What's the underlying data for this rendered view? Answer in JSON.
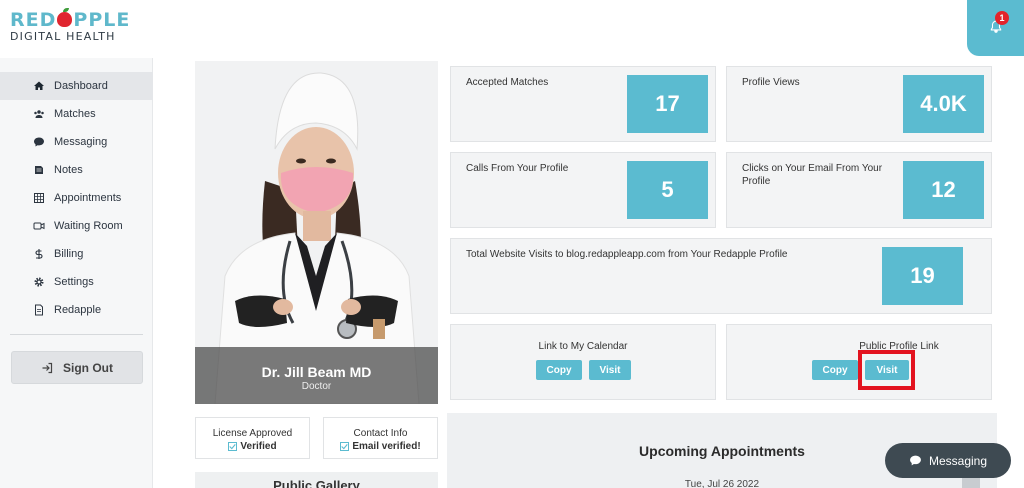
{
  "brand": {
    "line1_a": "RED",
    "line1_b": "PPLE",
    "line2": "DIGITAL HEALTH"
  },
  "header": {
    "notification_count": "1"
  },
  "sidebar": {
    "items": [
      {
        "label": "Dashboard",
        "icon": "home-icon"
      },
      {
        "label": "Matches",
        "icon": "users-icon"
      },
      {
        "label": "Messaging",
        "icon": "chat-icon"
      },
      {
        "label": "Notes",
        "icon": "notes-icon"
      },
      {
        "label": "Appointments",
        "icon": "calendar-grid-icon"
      },
      {
        "label": "Waiting Room",
        "icon": "video-icon"
      },
      {
        "label": "Billing",
        "icon": "dollar-icon"
      },
      {
        "label": "Settings",
        "icon": "gear-icon"
      },
      {
        "label": "Redapple",
        "icon": "document-icon"
      }
    ],
    "active_index": 0,
    "sign_out": "Sign Out"
  },
  "profile": {
    "name": "Dr. Jill Beam MD",
    "role": "Doctor"
  },
  "stats": {
    "accepted_matches": {
      "label": "Accepted Matches",
      "value": "17"
    },
    "profile_views": {
      "label": "Profile Views",
      "value": "4.0K"
    },
    "calls": {
      "label": "Calls From Your Profile",
      "value": "5"
    },
    "email_clicks": {
      "label": "Clicks on Your Email From Your Profile",
      "value": "12"
    },
    "website_visits": {
      "label": "Total Website Visits to blog.redappleapp.com from Your Redapple Profile",
      "value": "19"
    }
  },
  "links": {
    "calendar": {
      "title": "Link to My Calendar",
      "copy": "Copy",
      "visit": "Visit"
    },
    "public_profile": {
      "title": "Public Profile Link",
      "copy": "Copy",
      "visit": "Visit"
    }
  },
  "verification": {
    "license": {
      "title": "License Approved",
      "status": "Verified"
    },
    "contact": {
      "title": "Contact Info",
      "status": "Email verified!"
    }
  },
  "gallery": {
    "title": "Public Gallery"
  },
  "upcoming": {
    "title": "Upcoming Appointments",
    "date": "Tue, Jul 26 2022"
  },
  "messaging_button": "Messaging",
  "colors": {
    "accent": "#5bbbd0",
    "brand_red": "#e0262f",
    "highlight": "#e3131f",
    "dark": "#3e4a52"
  }
}
